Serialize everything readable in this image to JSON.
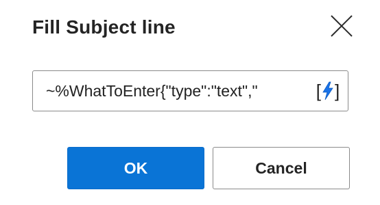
{
  "dialog": {
    "title": "Fill Subject line",
    "close_icon": "close-icon"
  },
  "field": {
    "value": "~%WhatToEnter{\"type\":\"text\",\"",
    "variable_icon": "lightning-bolt-icon",
    "bracket_open": "[",
    "bracket_close": "]"
  },
  "buttons": {
    "ok_label": "OK",
    "cancel_label": "Cancel"
  },
  "colors": {
    "primary": "#0a74d6",
    "bolt": "#1a73e8",
    "text": "#242424"
  }
}
